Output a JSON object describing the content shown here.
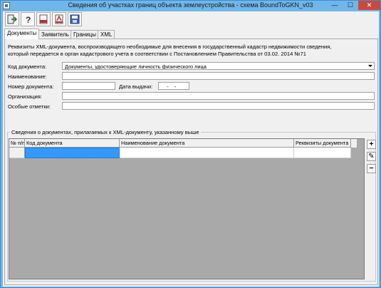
{
  "window": {
    "title": "Сведения об участках границ объекта землеустройства - схема BoundToGKN_v03",
    "minimize": "—",
    "maximize": "☐",
    "close": "✕"
  },
  "toolbar": {
    "buttons": [
      {
        "name": "exit-icon"
      },
      {
        "name": "help-icon"
      },
      {
        "name": "pdf-icon"
      },
      {
        "name": "pdf-form-icon"
      },
      {
        "name": "save-disk-icon"
      }
    ]
  },
  "tabs": [
    {
      "label": "Документы",
      "active": true
    },
    {
      "label": "Заявитель",
      "active": false
    },
    {
      "label": "Границы",
      "active": false
    },
    {
      "label": "XML",
      "active": false
    }
  ],
  "documents": {
    "info_line1": "Реквизиты XML-документа, воспроизводящего необходимые для внесения в государственный кадастр недвижимости сведения,",
    "info_line2": "который передается в орган кадастрового учета в соответствии с Постановлением Правительства от 03.02. 2014 №71",
    "form": {
      "doc_code_label": "Код документа:",
      "doc_code_value": "Документы, удостоверяющие личность физического лица",
      "name_label": "Наименование:",
      "name_value": "",
      "number_label": "Номер документа:",
      "number_value": "",
      "issue_date_label": "Дата выдачи:",
      "issue_date_value": "__-__-__",
      "organization_label": "Организация:",
      "organization_value": "",
      "special_notes_label": "Особые отметки:",
      "special_notes_value": ""
    },
    "attached": {
      "group_title": "Сведения о документах, прилагаемых к XML-документу, указанному выше",
      "columns": [
        "№ п/п",
        "Код документа",
        "Наименование документа",
        "Реквизиты документа"
      ],
      "side_buttons": {
        "add": "+",
        "edit": "✎",
        "remove": "−"
      }
    }
  }
}
